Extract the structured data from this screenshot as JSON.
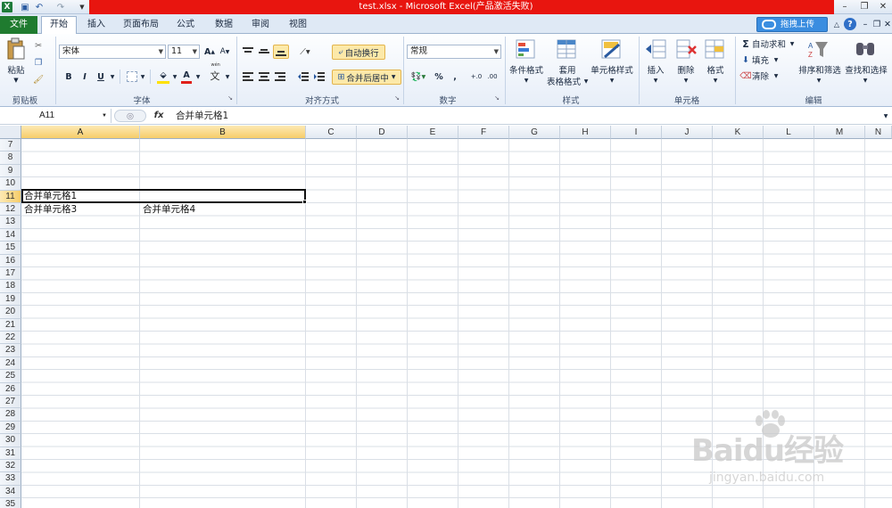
{
  "window": {
    "title": "test.xlsx - Microsoft Excel(产品激活失败)",
    "quick_access": [
      "save-icon",
      "undo-icon",
      "redo-icon",
      "customize-icon"
    ]
  },
  "tabs": {
    "file": "文件",
    "home": "开始",
    "insert": "插入",
    "page_layout": "页面布局",
    "formulas": "公式",
    "data": "数据",
    "review": "审阅",
    "view": "视图",
    "upload": "拖拽上传"
  },
  "ribbon": {
    "clipboard": {
      "paste": "粘贴",
      "label": "剪贴板"
    },
    "font": {
      "name": "宋体",
      "size": "11",
      "label": "字体",
      "bold": "B",
      "italic": "I",
      "underline": "U",
      "font_color_glyph": "A",
      "phonetic": "wén"
    },
    "alignment": {
      "wrap": "自动换行",
      "merge": "合并后居中",
      "label": "对齐方式"
    },
    "number": {
      "format": "常规",
      "label": "数字",
      "percent": "%",
      "comma": ",",
      "inc_decimal": "+.0",
      "dec_decimal": ".00"
    },
    "styles": {
      "conditional": "条件格式",
      "table_line1": "套用",
      "table_line2": "表格格式",
      "cell_styles": "单元格样式",
      "label": "样式"
    },
    "cells": {
      "insert": "插入",
      "delete": "删除",
      "format": "格式",
      "label": "单元格"
    },
    "editing": {
      "autosum": "自动求和",
      "fill": "填充",
      "clear": "清除",
      "sort": "排序和筛选",
      "find": "查找和选择",
      "label": "编辑"
    }
  },
  "formula_bar": {
    "name_box": "A11",
    "fx": "fx",
    "content": "合并单元格1"
  },
  "columns": [
    "A",
    "B",
    "C",
    "D",
    "E",
    "F",
    "G",
    "H",
    "I",
    "J",
    "K",
    "L",
    "M",
    "N"
  ],
  "rows": [
    "7",
    "8",
    "9",
    "10",
    "11",
    "12",
    "13",
    "14",
    "15",
    "16",
    "17",
    "18",
    "19",
    "20",
    "21",
    "22",
    "23",
    "24",
    "25",
    "26",
    "27",
    "28",
    "29",
    "30",
    "31",
    "32",
    "33",
    "34",
    "35"
  ],
  "cells": {
    "a11": "合并单元格1",
    "a12": "合并单元格3",
    "b12": "合并单元格4"
  },
  "selection": {
    "range": "A11:B11"
  },
  "watermark": {
    "main": "Baidu经验",
    "sub": "jingyan.baidu.com"
  },
  "colors": {
    "title_red": "#e8150f",
    "file_tab": "#1f7b2f",
    "selection_header": "#f6cd6a",
    "upload_blue": "#3a8de0"
  }
}
